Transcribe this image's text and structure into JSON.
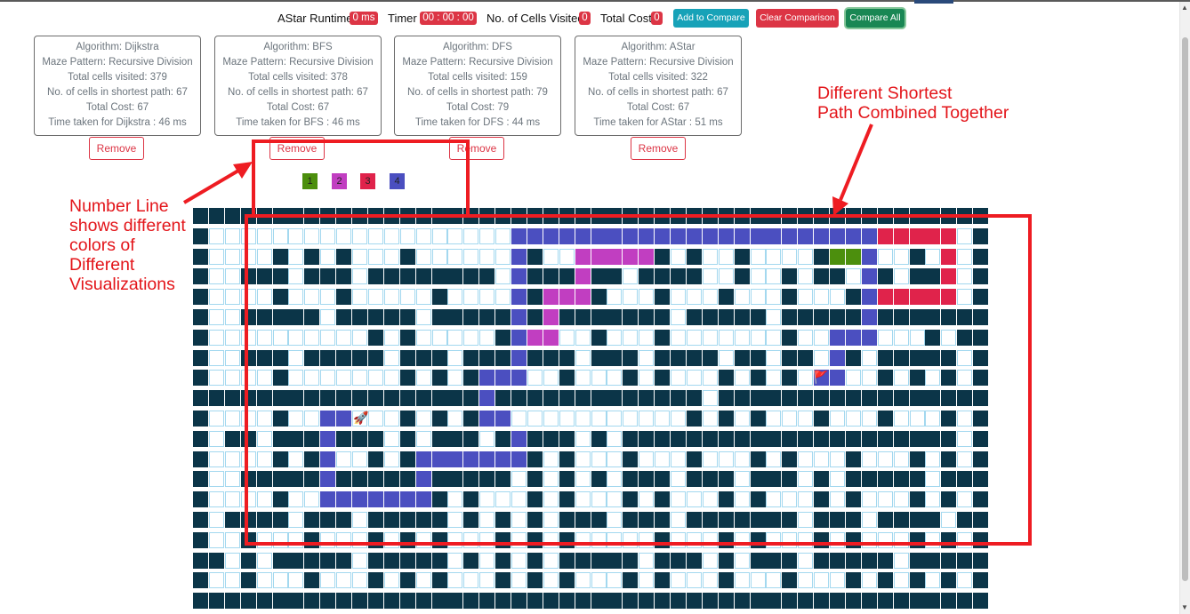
{
  "stats": {
    "runtime_label": "AStar Runtime",
    "runtime_value": "0 ms",
    "timer_label": "Timer",
    "timer_value": "00 : 00 : 00",
    "visited_label": "No. of Cells Visited",
    "visited_value": "0",
    "cost_label": "Total Cost",
    "cost_value": "0"
  },
  "buttons": {
    "add_compare": "Add to Compare",
    "clear_comparison": "Clear Comparison",
    "compare_all": "Compare All",
    "remove": "Remove"
  },
  "cards": [
    {
      "lines": [
        "Algorithm: Dijkstra",
        "Maze Pattern: Recursive Division",
        "Total cells visited: 379",
        "No. of cells in shortest path: 67",
        "Total Cost: 67",
        "Time taken for Dijkstra : 46 ms"
      ]
    },
    {
      "lines": [
        "Algorithm: BFS",
        "Maze Pattern: Recursive Division",
        "Total cells visited: 378",
        "No. of cells in shortest path: 67",
        "Total Cost: 67",
        "Time taken for BFS : 46 ms"
      ]
    },
    {
      "lines": [
        "Algorithm: DFS",
        "Maze Pattern: Recursive Division",
        "Total cells visited: 159",
        "No. of cells in shortest path: 79",
        "Total Cost: 79",
        "Time taken for DFS : 44 ms"
      ]
    },
    {
      "lines": [
        "Algorithm: AStar",
        "Maze Pattern: Recursive Division",
        "Total cells visited: 322",
        "No. of cells in shortest path: 67",
        "Total Cost: 67",
        "Time taken for AStar : 51 ms"
      ]
    }
  ],
  "legend": [
    {
      "label": "1",
      "color": "#4c8f0d"
    },
    {
      "label": "2",
      "color": "#c13ec1"
    },
    {
      "label": "3",
      "color": "#e0234b"
    },
    {
      "label": "4",
      "color": "#4b4fc0"
    }
  ],
  "colors": {
    "wall": "#0b3548",
    "path_1": "#4c8f0d",
    "path_2": "#c13ec1",
    "path_3": "#e0234b",
    "path_4": "#4b4fc0",
    "annotation": "#e3151a"
  },
  "markers": {
    "start_icon": "rocket-icon",
    "end_icon": "flag-icon"
  },
  "annotations": {
    "number_line": [
      "Number Line",
      "shows different",
      "colors of",
      "Different",
      "Visualizations"
    ],
    "shortest_path": [
      "Different Shortest",
      "Path Combined Together"
    ]
  }
}
